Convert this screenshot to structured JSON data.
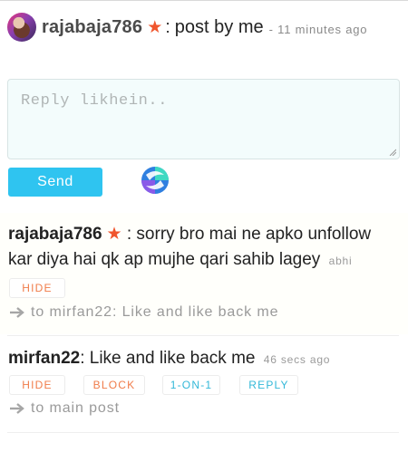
{
  "post": {
    "username": "rajabaja786",
    "separator": ":",
    "title": "post by me",
    "time": "- 11 minutes ago"
  },
  "reply": {
    "placeholder": "Reply likhein..",
    "send_label": "Send"
  },
  "messages": [
    {
      "username": "rajabaja786",
      "separator": ":",
      "text": "sorry bro mai ne apko unfollow kar diya hai qk ap mujhe qari sahib lagey",
      "time": "abhi",
      "buttons": {
        "hide": "HIDE"
      },
      "ref": "to mirfan22: Like and like back me"
    },
    {
      "username": "mirfan22",
      "separator": ":",
      "text": "Like and like back me",
      "time": "46 secs ago",
      "buttons": {
        "hide": "HIDE",
        "block": "BLOCK",
        "one_on_one": "1-ON-1",
        "reply": "REPLY"
      },
      "ref": "to main post"
    }
  ],
  "colors": {
    "accent": "#2fc4f0",
    "star": "#f0552d",
    "action_orange": "#f07c4a",
    "action_blue": "#33b8d8"
  },
  "icons": [
    "avatar",
    "star-icon",
    "resize-grip-icon",
    "spinner-logo-icon",
    "arrow-right-icon"
  ]
}
